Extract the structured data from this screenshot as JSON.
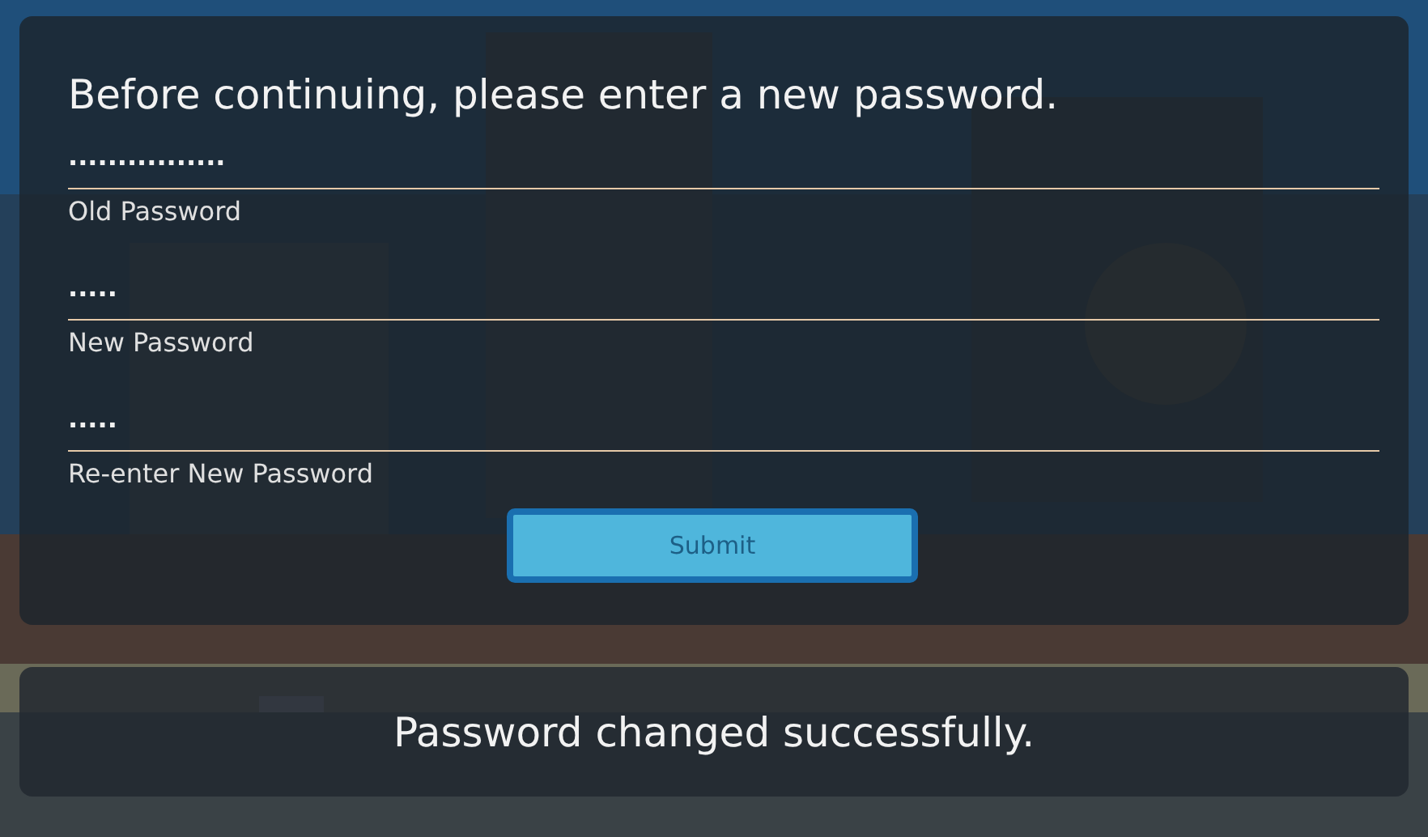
{
  "prompt": "Before continuing, please enter a new password.",
  "fields": [
    {
      "value": "................",
      "label": "Old Password"
    },
    {
      "value": ".....",
      "label": "New Password"
    },
    {
      "value": ".....",
      "label": "Re-enter New Password"
    }
  ],
  "submit": {
    "label": "Submit",
    "disabled": true
  },
  "message": "Password changed successfully."
}
